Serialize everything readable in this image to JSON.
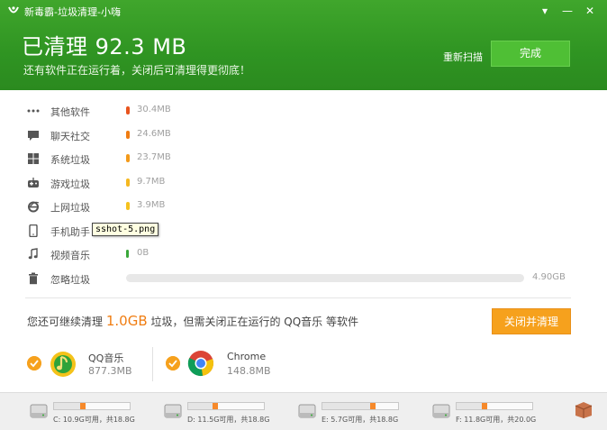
{
  "window": {
    "title": "新毒霸-垃圾清理-小嗨",
    "controls": {
      "menu": "▾",
      "minimize": "—",
      "close": "✕"
    }
  },
  "header": {
    "headline": "已清理 92.3 MB",
    "subline": "还有软件正在运行着，关闭后可清理得更彻底！",
    "rescan": "重新扫描",
    "done": "完成"
  },
  "categories": [
    {
      "name": "其他软件",
      "size": "30.4MB",
      "icon": "more-dots-icon",
      "color": "#e8541e"
    },
    {
      "name": "聊天社交",
      "size": "24.6MB",
      "icon": "chat-bubble-icon",
      "color": "#f07d12"
    },
    {
      "name": "系统垃圾",
      "size": "23.7MB",
      "icon": "windows-icon",
      "color": "#f39a1a"
    },
    {
      "name": "游戏垃圾",
      "size": "9.7MB",
      "icon": "gamepad-icon",
      "color": "#f5b820"
    },
    {
      "name": "上网垃圾",
      "size": "3.9MB",
      "icon": "ie-browser-icon",
      "color": "#f5c21e"
    },
    {
      "name": "手机助手",
      "size": "",
      "icon": "phone-icon",
      "color": ""
    },
    {
      "name": "视频音乐",
      "size": "0B",
      "icon": "music-note-icon",
      "color": "#3aa83a"
    },
    {
      "name": "忽略垃圾",
      "size": "4.90GB",
      "icon": "trash-icon",
      "color": "#e8e8e8"
    }
  ],
  "tooltip": "sshot-5.png",
  "more": {
    "prefix": "您还可继续清理",
    "amount": "1.0GB",
    "suffix": "垃圾，但需关闭正在运行的 QQ音乐 等软件",
    "button": "关闭并清理"
  },
  "running_apps": [
    {
      "name": "QQ音乐",
      "size": "877.3MB",
      "icon": "qq-music-icon"
    },
    {
      "name": "Chrome",
      "size": "148.8MB",
      "icon": "chrome-icon"
    }
  ],
  "disks": [
    {
      "label": "C: 10.9G可用，共18.8G",
      "used_fraction": 0.42
    },
    {
      "label": "D: 11.5G可用，共18.8G",
      "used_fraction": 0.39
    },
    {
      "label": "E: 5.7G可用，共18.8G",
      "used_fraction": 0.7
    },
    {
      "label": "F: 11.8G可用，共20.0G",
      "used_fraction": 0.41
    }
  ]
}
